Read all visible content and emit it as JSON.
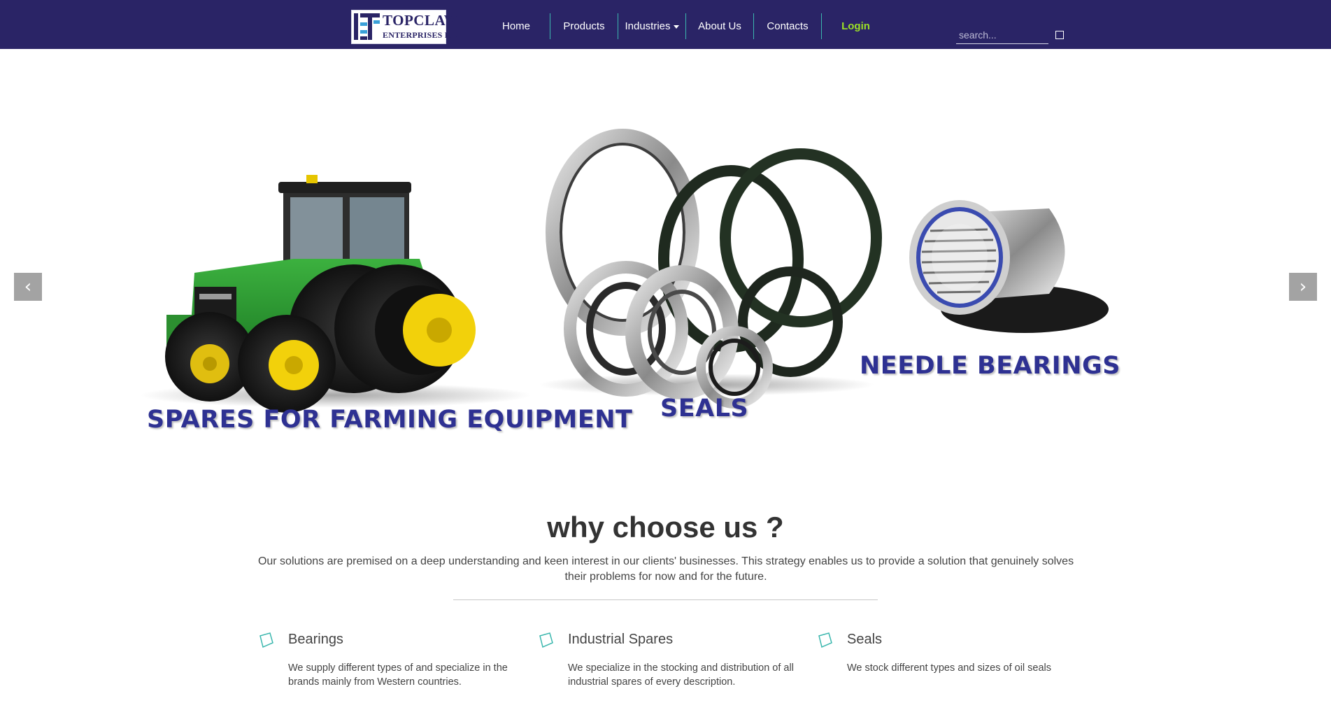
{
  "logo": {
    "line1": "TOPCLAW",
    "line2": "ENTERPRISES P.L"
  },
  "nav": {
    "home": "Home",
    "products": "Products",
    "industries": "Industries",
    "about": "About Us",
    "contacts": "Contacts",
    "login": "Login"
  },
  "search": {
    "placeholder": "search..."
  },
  "carousel": {
    "captions": {
      "farming": "SPARES FOR FARMING EQUIPMENT",
      "seals": "SEALS",
      "needle": "NEEDLE BEARINGS"
    },
    "prev_icon": "chevron-left-icon",
    "next_icon": "chevron-right-icon",
    "prev_glyph": "‹",
    "next_glyph": "›"
  },
  "why": {
    "title": "why choose us ?",
    "text": "Our solutions are premised on a deep understanding and keen interest in our clients' businesses. This strategy enables us to provide a solution that genuinely solves their problems for now and for the future."
  },
  "features": [
    {
      "title": "Bearings",
      "text": "We supply different types of and specialize in the brands mainly from Western countries.",
      "icon": "diamond-icon"
    },
    {
      "title": "Industrial Spares",
      "text": "We specialize in the stocking and distribution of all industrial spares of every description.",
      "icon": "diamond-icon"
    },
    {
      "title": "Seals",
      "text": "We stock different types and sizes of oil seals",
      "icon": "diamond-icon"
    }
  ],
  "colors": {
    "navbar": "#2a2466",
    "nav_divider": "#3bb7ae",
    "login": "#9be026",
    "caption": "#2e3192",
    "feature_icon": "#3bb7ae"
  }
}
